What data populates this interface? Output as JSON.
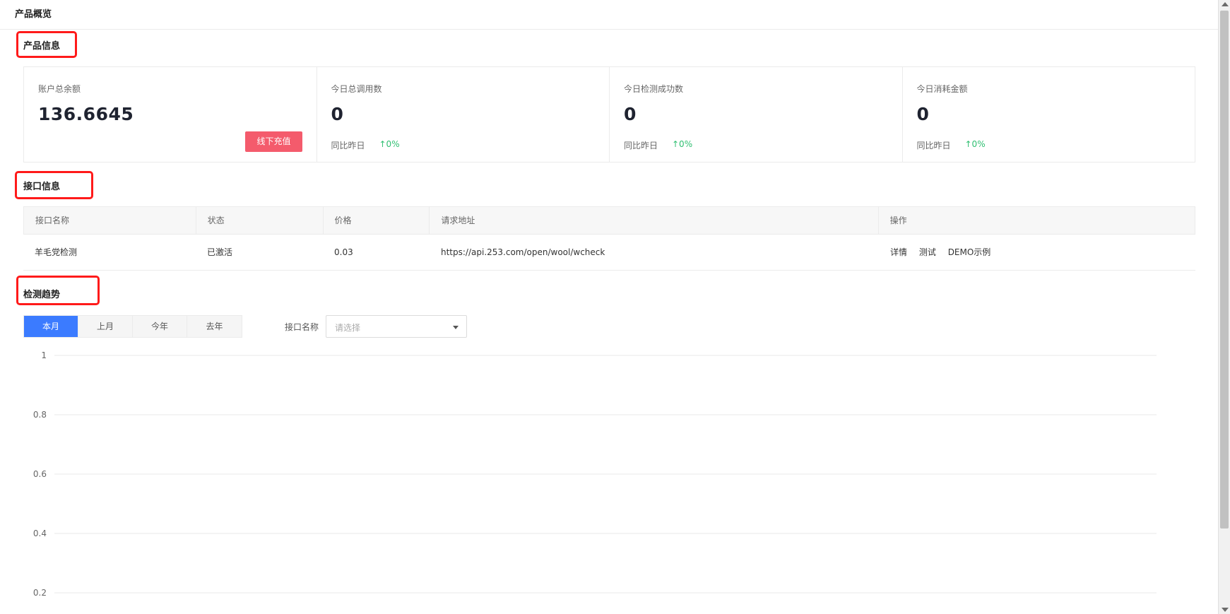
{
  "page": {
    "title": "产品概览"
  },
  "sections": {
    "product_info": "产品信息",
    "api_info": "接口信息",
    "trend": "检测趋势"
  },
  "cards": [
    {
      "label": "账户总余额",
      "value": "136.6645",
      "button": "线下充值"
    },
    {
      "label": "今日总调用数",
      "value": "0",
      "compare_label": "同比昨日",
      "trend": "↑0%"
    },
    {
      "label": "今日检测成功数",
      "value": "0",
      "compare_label": "同比昨日",
      "trend": "↑0%"
    },
    {
      "label": "今日消耗金额",
      "value": "0",
      "compare_label": "同比昨日",
      "trend": "↑0%"
    }
  ],
  "api_table": {
    "columns": [
      "接口名称",
      "状态",
      "价格",
      "请求地址",
      "操作"
    ],
    "rows": [
      {
        "name": "羊毛党检测",
        "status": "已激活",
        "price": "0.03",
        "url": "https://api.253.com/open/wool/wcheck",
        "actions": [
          "详情",
          "测试",
          "DEMO示例"
        ]
      }
    ]
  },
  "trend_filters": {
    "periods": [
      "本月",
      "上月",
      "今年",
      "去年"
    ],
    "active_period": "本月",
    "api_label": "接口名称",
    "api_select_placeholder": "请选择"
  },
  "colors": {
    "accent": "#3b7bff",
    "recharge_button": "#f45b6c",
    "trend_up": "#2fbf71",
    "highlight_box": "#ff1a1a"
  },
  "chart_data": {
    "type": "line",
    "series": [],
    "yticks": [
      "1",
      "0.8",
      "0.6",
      "0.4",
      "0.2"
    ],
    "ylim": [
      0,
      1
    ],
    "grid": true
  }
}
